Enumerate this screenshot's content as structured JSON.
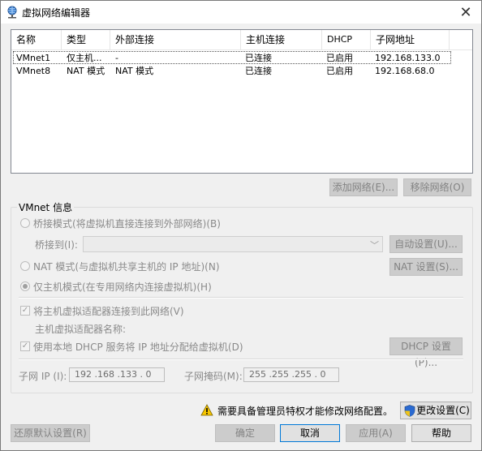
{
  "window": {
    "title": "虚拟网络编辑器",
    "close": "✕"
  },
  "table": {
    "columns": [
      "名称",
      "类型",
      "外部连接",
      "主机连接",
      "DHCP",
      "子网地址"
    ],
    "rows": [
      [
        "VMnet1",
        "仅主机...",
        "-",
        "已连接",
        "已启用",
        "192.168.133.0"
      ],
      [
        "VMnet8",
        "NAT 模式",
        "NAT 模式",
        "已连接",
        "已启用",
        "192.168.68.0"
      ]
    ]
  },
  "buttons": {
    "add_network": "添加网络(E)...",
    "remove_network": "移除网络(O)",
    "auto_settings": "自动设置(U)...",
    "nat_settings": "NAT 设置(S)...",
    "dhcp_settings": "DHCP 设置(P)...",
    "change_settings": "更改设置(C)",
    "restore_defaults": "还原默认设置(R)",
    "ok": "确定",
    "cancel": "取消",
    "apply": "应用(A)",
    "help": "帮助"
  },
  "vmnet_info": {
    "title": "VMnet 信息",
    "bridged_mode": "桥接模式(将虚拟机直接连接到外部网络)(B)",
    "bridged_to_label": "桥接到(I):",
    "nat_mode": "NAT 模式(与虚拟机共享主机的 IP 地址)(N)",
    "host_only_mode": "仅主机模式(在专用网络内连接虚拟机)(H)",
    "connect_adapter": "将主机虚拟适配器连接到此网络(V)",
    "adapter_name_label": "主机虚拟适配器名称:",
    "use_dhcp": "使用本地 DHCP 服务将 IP 地址分配给虚拟机(D)",
    "subnet_ip_label": "子网 IP (I):",
    "subnet_ip": "192 .168 .133 . 0",
    "subnet_mask_label": "子网掩码(M):",
    "subnet_mask": "255 .255 .255 . 0"
  },
  "admin_warning": "需要具备管理员特权才能修改网络配置。"
}
